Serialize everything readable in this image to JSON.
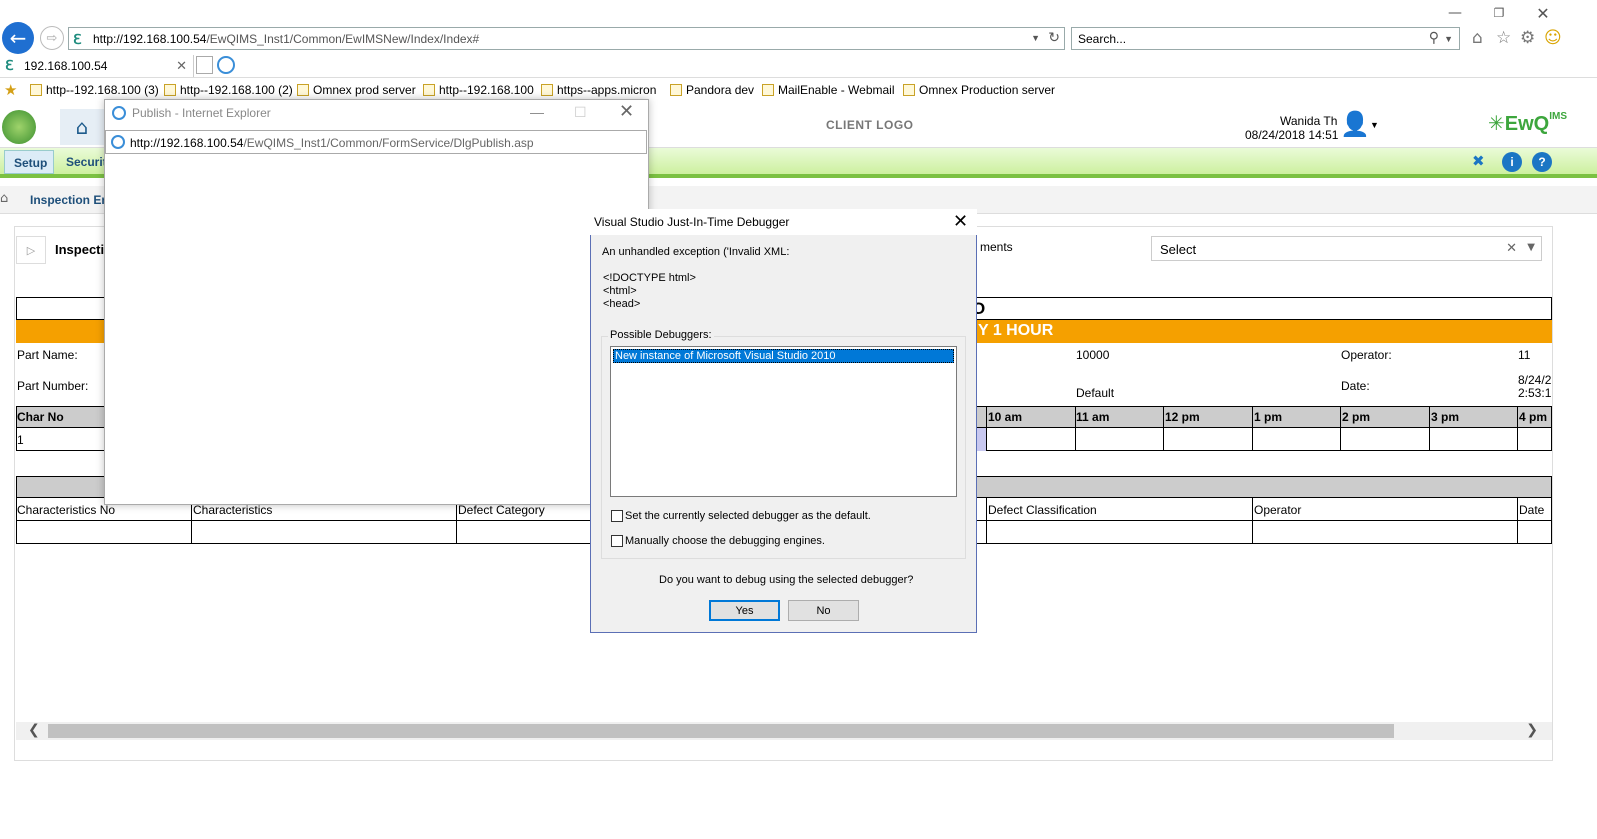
{
  "browser": {
    "address_url": "http://192.168.100.54/EwQIMS_Inst1/Common/EwIMSNew/Index/Index#",
    "address_host": "http://192.168.100.54",
    "address_path": "/EwQIMS_Inst1/Common/EwIMSNew/Index/Index#",
    "search_placeholder": "Search...",
    "tab_title": "192.168.100.54",
    "favorites": [
      "http--192.168.100 (3)",
      "http--192.168.100 (2)",
      "Omnex prod server",
      "http--192.168.100",
      "https--apps.micron",
      "Pandora dev",
      "MailEnable - Webmail",
      "Omnex Production server"
    ]
  },
  "app": {
    "client_logo": "CLIENT LOGO",
    "user_name": "Wanida Th",
    "datetime": "08/24/2018 14:51",
    "brand": "EwQ",
    "brand_sub": "IMS",
    "menu": [
      "Setup",
      "Securit"
    ],
    "breadcrumb": "Inspection En",
    "panel_title": "Inspecti",
    "attachments_label": "ments",
    "select_value": "Select",
    "heading_fragment": "O",
    "orange_heading": "Y 1 HOUR",
    "fields": {
      "part_name_label": "Part Name:",
      "part_number_label": "Part Number:",
      "value_10000": "10000",
      "value_default": "Default",
      "operator_label": "Operator:",
      "operator_value": "11",
      "date_label": "Date:",
      "date_value_1": "8/24/2",
      "date_value_2": "2:53:1"
    },
    "char_header": "Char No",
    "char_row_value": "1",
    "hours": [
      "10 am",
      "11 am",
      "12 pm",
      "1 pm",
      "2 pm",
      "3 pm",
      "4 pm"
    ],
    "defect_headers": [
      "Characteristics No",
      "Characteristics",
      "Defect Category",
      "Defect Classification",
      "Operator",
      "Date"
    ]
  },
  "publish_popup": {
    "title": "Publish - Internet Explorer",
    "url_host": "http://192.168.100.54",
    "url_path": "/EwQIMS_Inst1/Common/FormService/DlgPublish.asp"
  },
  "debugger": {
    "title": "Visual Studio Just-In-Time Debugger",
    "message": "An unhandled exception ('Invalid XML:",
    "code": "<!DOCTYPE html>\n<html>\n<head>",
    "group_label": "Possible Debuggers:",
    "list_items": [
      "New instance of Microsoft Visual Studio 2010"
    ],
    "check_default": "Set the currently selected debugger as the default.",
    "check_manual": "Manually choose the debugging engines.",
    "question": "Do you want to debug using the selected debugger?",
    "yes_label": "Yes",
    "no_label": "No"
  }
}
